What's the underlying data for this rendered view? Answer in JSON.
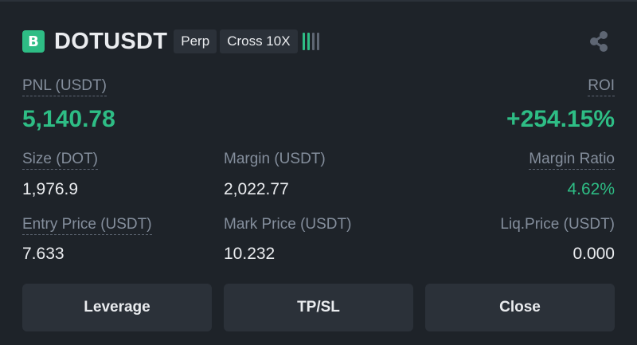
{
  "header": {
    "side_badge": "B",
    "symbol": "DOTUSDT",
    "contract_type": "Perp",
    "margin_mode": "Cross 10X",
    "risk_bars_icon": "signal-bars-icon",
    "share_icon": "share-icon"
  },
  "pnl": {
    "label": "PNL (USDT)",
    "value": "5,140.78"
  },
  "roi": {
    "label": "ROI",
    "value": "+254.15%"
  },
  "size": {
    "label": "Size (DOT)",
    "value": "1,976.9"
  },
  "margin": {
    "label": "Margin (USDT)",
    "value": "2,022.77"
  },
  "margin_ratio": {
    "label": "Margin Ratio",
    "value": "4.62%"
  },
  "entry_price": {
    "label": "Entry Price (USDT)",
    "value": "7.633"
  },
  "mark_price": {
    "label": "Mark Price (USDT)",
    "value": "10.232"
  },
  "liq_price": {
    "label": "Liq.Price (USDT)",
    "value": "0.000"
  },
  "buttons": {
    "leverage": "Leverage",
    "tpsl": "TP/SL",
    "close": "Close"
  },
  "colors": {
    "background": "#1e2329",
    "positive": "#2ebd85",
    "muted_text": "#848e9c",
    "surface": "#2b3139"
  }
}
